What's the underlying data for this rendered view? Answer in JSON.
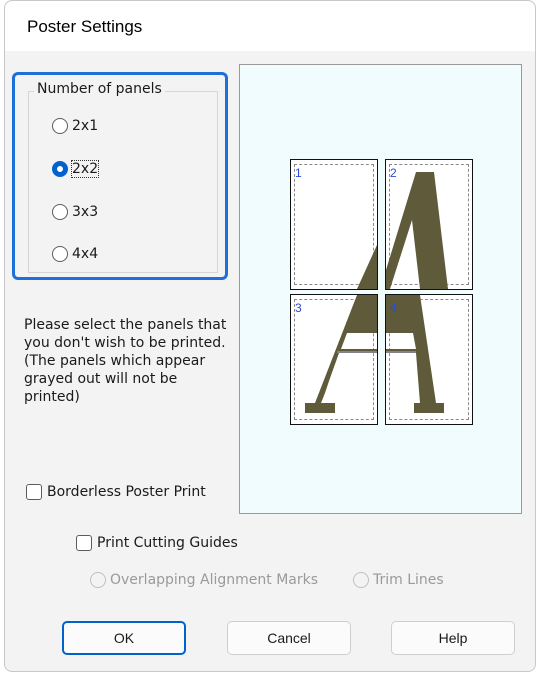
{
  "dialog": {
    "title": "Poster Settings"
  },
  "panels_group": {
    "legend": "Number of panels",
    "options": [
      {
        "label": "2x1",
        "checked": false
      },
      {
        "label": "2x2",
        "checked": true
      },
      {
        "label": "3x3",
        "checked": false
      },
      {
        "label": "4x4",
        "checked": false
      }
    ]
  },
  "description": "Please select the panels that you don't wish to be printed. (The panels which appear grayed out will not be printed)",
  "borderless": {
    "label": "Borderless Poster Print",
    "checked": false
  },
  "cutting_guides": {
    "label": "Print Cutting Guides",
    "checked": false
  },
  "guide_options": {
    "overlapping": "Overlapping Alignment Marks",
    "trim": "Trim Lines"
  },
  "preview": {
    "panel_numbers": [
      "1",
      "2",
      "3",
      "4"
    ]
  },
  "buttons": {
    "ok": "OK",
    "cancel": "Cancel",
    "help": "Help"
  },
  "colors": {
    "accent": "#0062cc",
    "highlight": "#1e6fd9",
    "preview_bg": "#f0fcfd",
    "glyph": "#5e5a3a",
    "panel_number": "#2a4bd7"
  }
}
